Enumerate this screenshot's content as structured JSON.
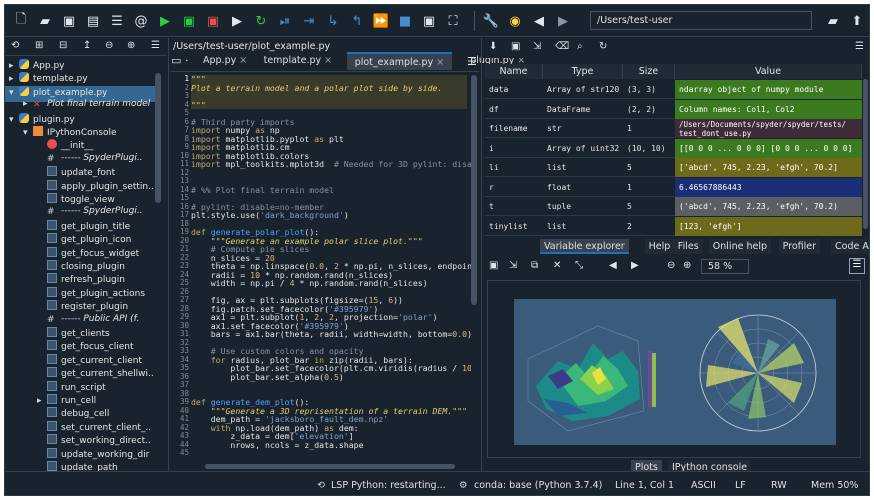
{
  "toolbar": {
    "path": "/Users/test-user"
  },
  "files": {
    "items": [
      {
        "label": "App.py",
        "icon": "python-file-icon",
        "indent": 0,
        "arrow": "▸"
      },
      {
        "label": "template.py",
        "icon": "python-file-icon",
        "indent": 0,
        "arrow": "▸"
      },
      {
        "label": "plot_example.py",
        "icon": "python-file-icon",
        "indent": 0,
        "arrow": "▾",
        "selected": true
      },
      {
        "label": "Plot final terrain model",
        "icon": "close-icon",
        "indent": 1,
        "arrow": "▸",
        "italic": true
      },
      {
        "label": "plugin.py",
        "icon": "python-file-icon",
        "indent": 0,
        "arrow": "▾"
      },
      {
        "label": "IPythonConsole",
        "icon": "class-icon",
        "indent": 1,
        "arrow": "▾"
      },
      {
        "label": "__init__",
        "icon": "method-icon",
        "indent": 2,
        "arrow": ""
      },
      {
        "label": "------ SpyderPlugi..",
        "icon": "comment-icon",
        "indent": 2,
        "arrow": "",
        "italic": true
      },
      {
        "label": "update_font",
        "icon": "function-icon",
        "indent": 2,
        "arrow": ""
      },
      {
        "label": "apply_plugin_settin..",
        "icon": "function-icon",
        "indent": 2,
        "arrow": ""
      },
      {
        "label": "toggle_view",
        "icon": "function-icon",
        "indent": 2,
        "arrow": ""
      },
      {
        "label": "------ SpyderPlugi..",
        "icon": "comment-icon",
        "indent": 2,
        "arrow": "",
        "italic": true
      },
      {
        "label": "get_plugin_title",
        "icon": "function-icon",
        "indent": 2,
        "arrow": ""
      },
      {
        "label": "get_plugin_icon",
        "icon": "function-icon",
        "indent": 2,
        "arrow": ""
      },
      {
        "label": "get_focus_widget",
        "icon": "function-icon",
        "indent": 2,
        "arrow": ""
      },
      {
        "label": "closing_plugin",
        "icon": "function-icon",
        "indent": 2,
        "arrow": ""
      },
      {
        "label": "refresh_plugin",
        "icon": "function-icon",
        "indent": 2,
        "arrow": ""
      },
      {
        "label": "get_plugin_actions",
        "icon": "function-icon",
        "indent": 2,
        "arrow": ""
      },
      {
        "label": "register_plugin",
        "icon": "function-icon",
        "indent": 2,
        "arrow": ""
      },
      {
        "label": "------ Public API (f.",
        "icon": "comment-icon",
        "indent": 2,
        "arrow": "",
        "italic": true
      },
      {
        "label": "get_clients",
        "icon": "function-icon",
        "indent": 2,
        "arrow": ""
      },
      {
        "label": "get_focus_client",
        "icon": "function-icon",
        "indent": 2,
        "arrow": ""
      },
      {
        "label": "get_current_client",
        "icon": "function-icon",
        "indent": 2,
        "arrow": ""
      },
      {
        "label": "get_current_shellwi..",
        "icon": "function-icon",
        "indent": 2,
        "arrow": ""
      },
      {
        "label": "run_script",
        "icon": "function-icon",
        "indent": 2,
        "arrow": ""
      },
      {
        "label": "run_cell",
        "icon": "function-icon",
        "indent": 2,
        "arrow": "▸"
      },
      {
        "label": "debug_cell",
        "icon": "function-icon",
        "indent": 2,
        "arrow": ""
      },
      {
        "label": "set_current_client_..",
        "icon": "function-icon",
        "indent": 2,
        "arrow": ""
      },
      {
        "label": "set_working_direct..",
        "icon": "function-icon",
        "indent": 2,
        "arrow": ""
      },
      {
        "label": "update_working_dir",
        "icon": "function-icon",
        "indent": 2,
        "arrow": ""
      },
      {
        "label": "update_path",
        "icon": "function-icon",
        "indent": 2,
        "arrow": ""
      }
    ]
  },
  "editor": {
    "path": "/Users/test-user/plot_example.py",
    "tabs": [
      {
        "label": "App.py"
      },
      {
        "label": "template.py"
      },
      {
        "label": "plot_example.py",
        "active": true
      },
      {
        "label": "plugin.py"
      }
    ],
    "lines": [
      [
        [
          "dc",
          "\"\"\""
        ]
      ],
      [
        [
          "dc",
          "Plot a terrain model and a polar plot side by side."
        ]
      ],
      [
        [
          "",
          ""
        ]
      ],
      [
        [
          "dc",
          "\"\"\""
        ]
      ],
      [
        [
          "",
          ""
        ]
      ],
      [
        [
          "cm",
          "# Third party imports"
        ]
      ],
      [
        [
          "kw",
          "import"
        ],
        [
          "",
          " numpy "
        ],
        [
          "kw",
          "as"
        ],
        [
          "",
          " np"
        ]
      ],
      [
        [
          "kw",
          "import"
        ],
        [
          "",
          " matplotlib.pyplot "
        ],
        [
          "kw",
          "as"
        ],
        [
          "",
          " plt"
        ]
      ],
      [
        [
          "kw",
          "import"
        ],
        [
          "",
          " matplotlib.cm"
        ]
      ],
      [
        [
          "kw",
          "import"
        ],
        [
          "",
          " matplotlib.colors"
        ]
      ],
      [
        [
          "kw",
          "import"
        ],
        [
          "",
          " mpl_toolkits.mplot3d  "
        ],
        [
          "cm",
          "# Needed for 3D pylint: disa"
        ]
      ],
      [
        [
          "",
          ""
        ]
      ],
      [
        [
          "",
          ""
        ]
      ],
      [
        [
          "cm",
          "# %% Plot final terrain model"
        ]
      ],
      [
        [
          "",
          ""
        ]
      ],
      [
        [
          "cm",
          "# pylint: disable=no-member"
        ]
      ],
      [
        [
          "",
          "plt.style.use("
        ],
        [
          "st",
          "'dark_background'"
        ],
        [
          "",
          ")"
        ]
      ],
      [
        [
          "",
          ""
        ]
      ],
      [
        [
          "kw",
          "def"
        ],
        [
          "",
          " "
        ],
        [
          "fn",
          "generate_polar_plot"
        ],
        [
          "",
          "():"
        ]
      ],
      [
        [
          "",
          "    "
        ],
        [
          "dc",
          "\"\"\"Generate an example polar slice plot.\"\"\""
        ]
      ],
      [
        [
          "",
          "    "
        ],
        [
          "cm",
          "# Compute pie slices"
        ]
      ],
      [
        [
          "",
          "    n_slices = "
        ],
        [
          "nm",
          "20"
        ]
      ],
      [
        [
          "",
          "    theta = np.linspace("
        ],
        [
          "nm",
          "0.0"
        ],
        [
          "",
          ", "
        ],
        [
          "nm",
          "2"
        ],
        [
          "",
          " * np.pi, n_slices, endpoin"
        ]
      ],
      [
        [
          "",
          "    radii = "
        ],
        [
          "nm",
          "10"
        ],
        [
          "",
          " * np.random.rand(n_slices)"
        ]
      ],
      [
        [
          "",
          "    width = np.pi / "
        ],
        [
          "nm",
          "4"
        ],
        [
          "",
          " * np.random.rand(n_slices)"
        ]
      ],
      [
        [
          "",
          ""
        ]
      ],
      [
        [
          "",
          "    fig, ax = plt.subplots(figsize=("
        ],
        [
          "nm",
          "15"
        ],
        [
          "",
          ", "
        ],
        [
          "nm",
          "6"
        ],
        [
          "",
          "))"
        ]
      ],
      [
        [
          "",
          "    fig.patch.set_facecolor("
        ],
        [
          "st",
          "'#395979'"
        ],
        [
          "",
          ")"
        ]
      ],
      [
        [
          "",
          "    ax1 = plt.subplot("
        ],
        [
          "nm",
          "1"
        ],
        [
          "",
          ", "
        ],
        [
          "nm",
          "2"
        ],
        [
          "",
          ", "
        ],
        [
          "nm",
          "2"
        ],
        [
          "",
          ", projection="
        ],
        [
          "st",
          "'polar'"
        ],
        [
          "",
          ")"
        ]
      ],
      [
        [
          "",
          "    ax1.set_facecolor("
        ],
        [
          "st",
          "'#395979'"
        ],
        [
          "",
          ")"
        ]
      ],
      [
        [
          "",
          "    bars = ax1.bar(theta, radii, width=width, bottom="
        ],
        [
          "nm",
          "0.0"
        ],
        [
          "",
          ")"
        ]
      ],
      [
        [
          "",
          ""
        ]
      ],
      [
        [
          "",
          "    "
        ],
        [
          "cm",
          "# Use custom colors and opacity"
        ]
      ],
      [
        [
          "",
          "    "
        ],
        [
          "kw",
          "for"
        ],
        [
          "",
          " radius, plot_bar "
        ],
        [
          "kw",
          "in"
        ],
        [
          "",
          " zip(radii, bars):"
        ]
      ],
      [
        [
          "",
          "        plot_bar.set_facecolor(plt.cm.viridis(radius / "
        ],
        [
          "nm",
          "10"
        ]
      ],
      [
        [
          "",
          "        plot_bar.set_alpha("
        ],
        [
          "nm",
          "0.5"
        ],
        [
          "",
          ")"
        ]
      ],
      [
        [
          "",
          ""
        ]
      ],
      [
        [
          "",
          ""
        ]
      ],
      [
        [
          "kw",
          "def"
        ],
        [
          "",
          " "
        ],
        [
          "fn",
          "generate_dem_plot"
        ],
        [
          "",
          "():"
        ]
      ],
      [
        [
          "",
          "    "
        ],
        [
          "dc",
          "\"\"\"Generate a 3D reprisentation of a terrain DEM.\"\"\""
        ]
      ],
      [
        [
          "",
          "    dem_path = "
        ],
        [
          "st",
          "'jacksboro_fault_dem.npz'"
        ]
      ],
      [
        [
          "",
          "    "
        ],
        [
          "kw",
          "with"
        ],
        [
          "",
          " np.load(dem_path) "
        ],
        [
          "kw",
          "as"
        ],
        [
          "",
          " dem:"
        ]
      ],
      [
        [
          "",
          "        z_data = dem["
        ],
        [
          "st",
          "'elevation'"
        ],
        [
          "",
          "]"
        ]
      ],
      [
        [
          "",
          "        nrows, ncols = z_data.shape"
        ]
      ],
      [
        [
          "",
          ""
        ]
      ]
    ]
  },
  "variables": {
    "headers": [
      "Name",
      "Type",
      "Size",
      "Value"
    ],
    "rows": [
      {
        "name": "data",
        "type": "Array of str120",
        "size": "(3, 3)",
        "value": "ndarray object of numpy module",
        "color": "#3b7a1e"
      },
      {
        "name": "df",
        "type": "DataFrame",
        "size": "(2, 2)",
        "value": "Column names: Col1, Col2",
        "color": "#3b7a1e"
      },
      {
        "name": "filename",
        "type": "str",
        "size": "1",
        "value": "/Users/Documents/spyder/spyder/tests/ test_dont_use.py",
        "color": "#3f2a3a"
      },
      {
        "name": "i",
        "type": "Array of uint32",
        "size": "(10, 10)",
        "value": "[[0 0 0 ... 0 0 0]  [0 0 0 ... 0 0 0]",
        "color": "#3b7a1e"
      },
      {
        "name": "li",
        "type": "list",
        "size": "5",
        "value": "['abcd', 745, 2.23, 'efgh', 70.2]",
        "color": "#6d6a1c"
      },
      {
        "name": "r",
        "type": "float",
        "size": "1",
        "value": "6.46567886443",
        "color": "#1c2e78"
      },
      {
        "name": "t",
        "type": "tuple",
        "size": "5",
        "value": "('abcd', 745, 2.23, 'efgh', 70.2)",
        "color": "#5b5f63"
      },
      {
        "name": "tinylist",
        "type": "list",
        "size": "2",
        "value": "[123, 'efgh']",
        "color": "#6d6a1c"
      }
    ]
  },
  "right_tabs": [
    "Variable explorer",
    "Help",
    "Files",
    "Online help",
    "Profiler",
    "Code Analysis"
  ],
  "plots": {
    "zoom": "58 %",
    "bottom_tabs": [
      "Plots",
      "IPython console"
    ]
  },
  "status": {
    "lsp": "LSP Python: restarting...",
    "conda": "conda: base (Python 3.7.4)",
    "position": "Line 1, Col 1",
    "encoding": "ASCII",
    "eol": "LF",
    "rw": "RW",
    "mem": "Mem 50%"
  }
}
